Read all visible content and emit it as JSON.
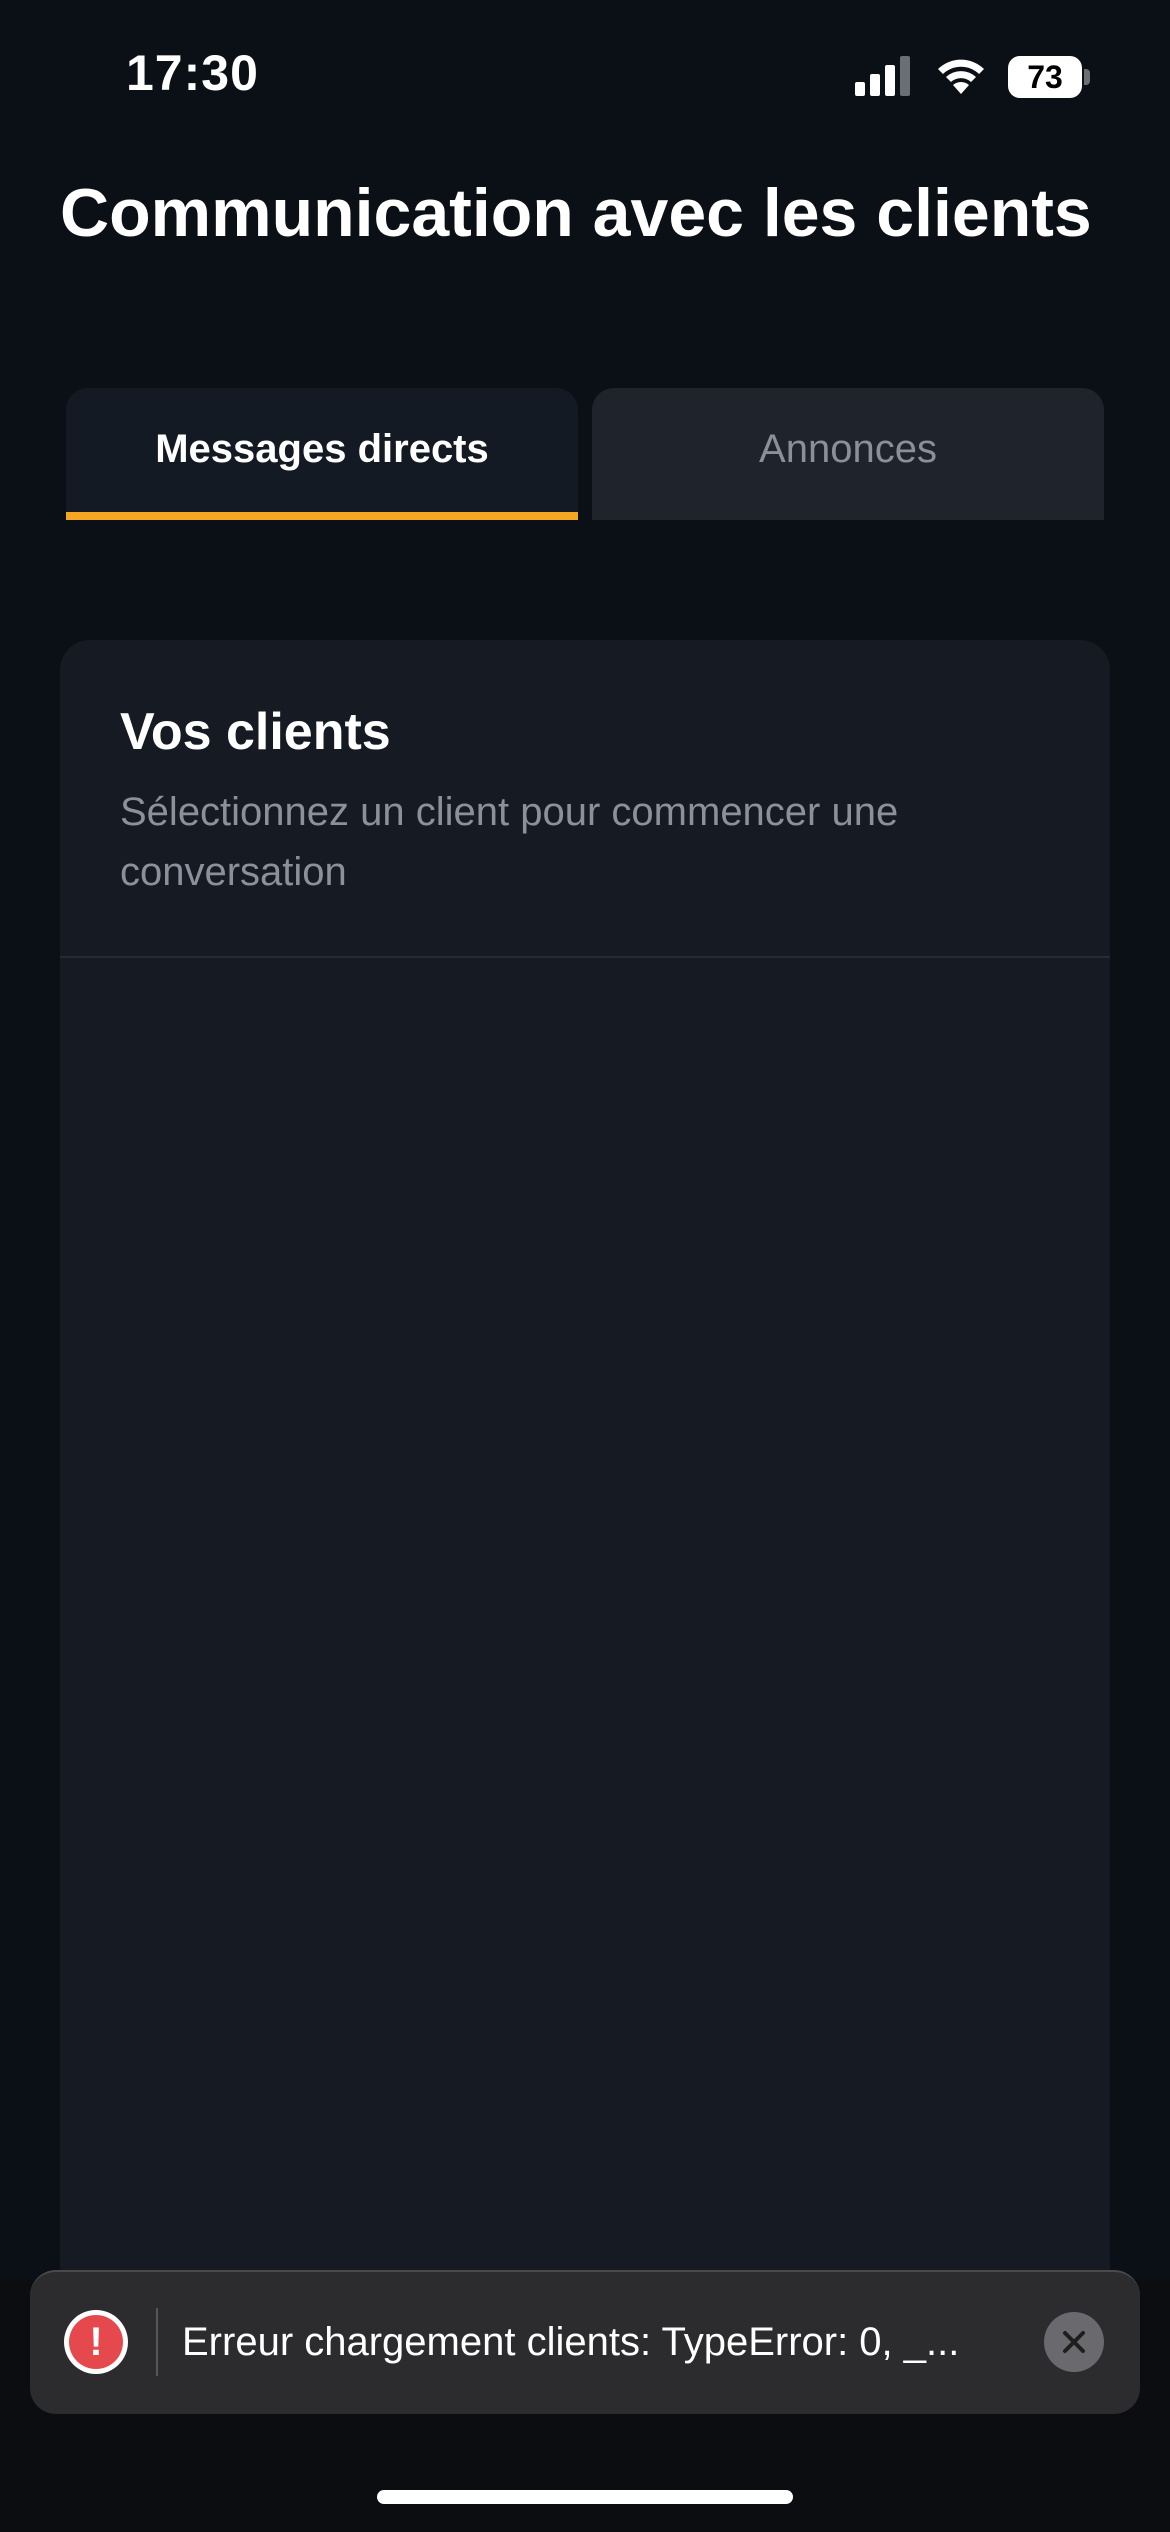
{
  "status_bar": {
    "time": "17:30",
    "battery_level": "73"
  },
  "header": {
    "title": "Communication avec les clients"
  },
  "tabs": [
    {
      "label": "Messages directs",
      "active": true
    },
    {
      "label": "Annonces",
      "active": false
    }
  ],
  "accent_color": "#f5a623",
  "clients_card": {
    "title": "Vos clients",
    "subtitle": "Sélectionnez un client pour commencer une conversation"
  },
  "toast": {
    "icon": "error-icon",
    "message": "Erreur chargement clients: TypeError: 0, _...",
    "close_icon": "close-icon"
  }
}
